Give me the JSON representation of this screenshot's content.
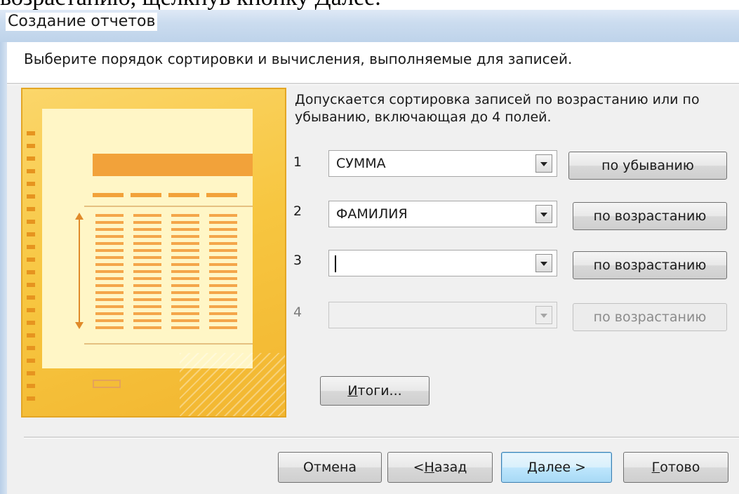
{
  "document": {
    "cropped_text": "возрастанию, щелкнув кнопку Далее."
  },
  "window": {
    "title": "Создание отчетов"
  },
  "wizard": {
    "prompt": "Выберите порядок сортировки и вычисления, выполняемые для записей.",
    "info_line1": "Допускается сортировка записей по возрастанию или по",
    "info_line2": "убыванию, включающая до 4 полей.",
    "sort_rows": [
      {
        "number": "1",
        "field": "СУММА",
        "order": "по убыванию",
        "enabled": true
      },
      {
        "number": "2",
        "field": "ФАМИЛИЯ",
        "order": "по возрастанию",
        "enabled": true
      },
      {
        "number": "3",
        "field": "",
        "order": "по возрастанию",
        "enabled": true
      },
      {
        "number": "4",
        "field": "",
        "order": "по возрастанию",
        "enabled": false
      }
    ],
    "summary_button": {
      "mnemonic": "И",
      "rest": "тоги..."
    }
  },
  "footer": {
    "cancel": "Отмена",
    "back": {
      "prefix": "< ",
      "mnemonic": "Н",
      "rest": "азад"
    },
    "next": {
      "mnemonic": "Д",
      "rest": "алее >"
    },
    "finish": {
      "mnemonic": "Г",
      "rest": "отово"
    }
  },
  "colors": {
    "illustration": "#f7c640",
    "default_button_border": "#3c7fb1"
  }
}
